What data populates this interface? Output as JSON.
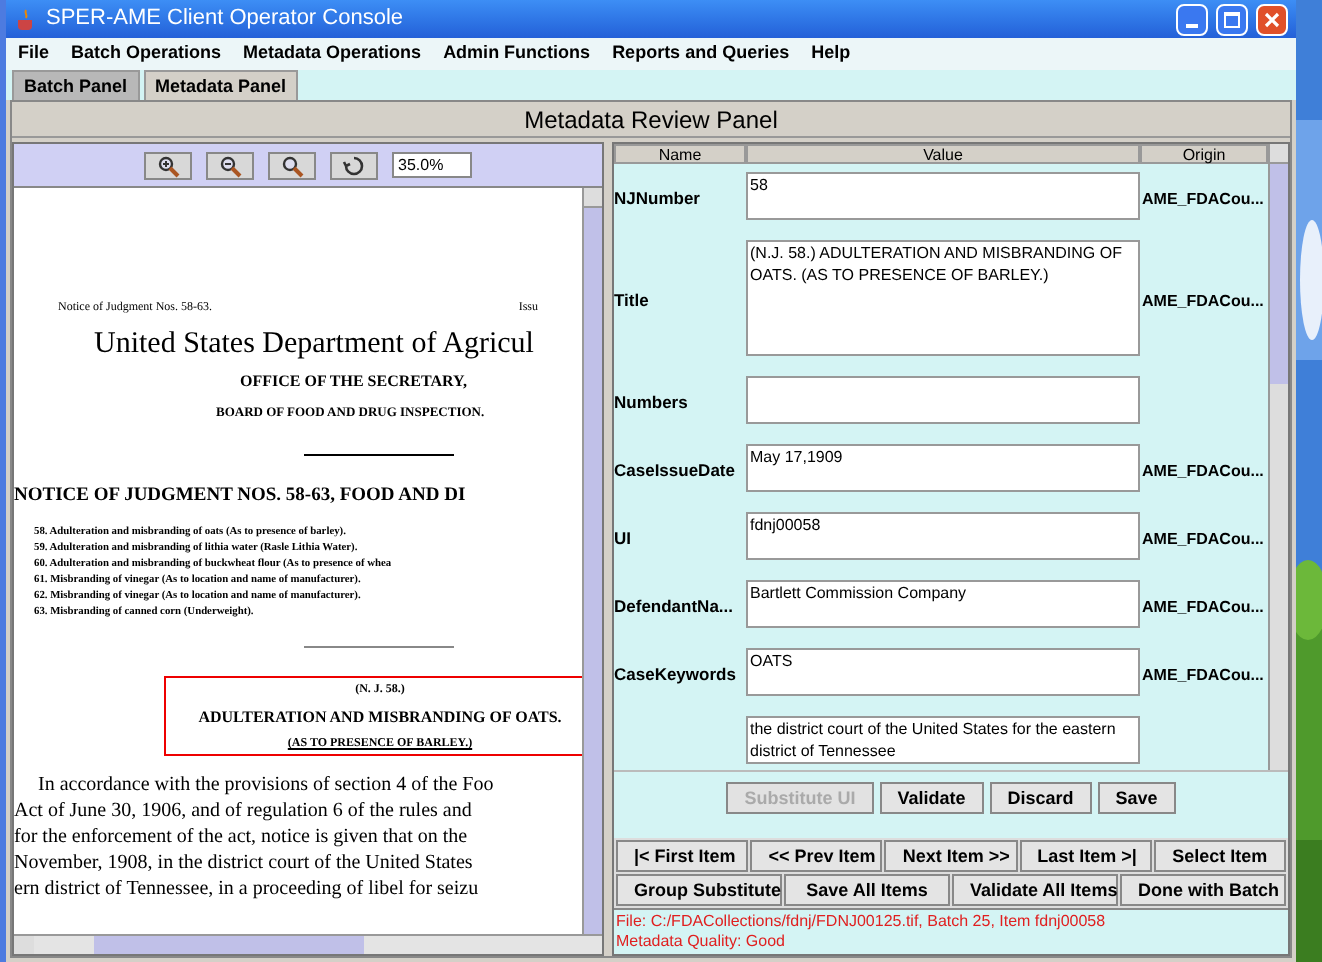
{
  "window": {
    "title": "SPER-AME Client Operator Console"
  },
  "menu": [
    "File",
    "Batch Operations",
    "Metadata Operations",
    "Admin Functions",
    "Reports and Queries",
    "Help"
  ],
  "tabs": [
    {
      "label": "Batch Panel",
      "selected": false
    },
    {
      "label": "Metadata Panel",
      "selected": true
    }
  ],
  "panel_title": "Metadata Review Panel",
  "viewer": {
    "zoom": "35.0%",
    "document": {
      "header_left": "Notice of Judgment Nos. 58-63.",
      "header_right": "Issu",
      "heading": "United States Department of Agricul",
      "office": "OFFICE OF THE SECRETARY,",
      "board": "BOARD OF FOOD AND DRUG INSPECTION.",
      "notice": "NOTICE OF JUDGMENT NOS. 58-63, FOOD AND DI",
      "items": [
        "58. Adulteration and misbranding of oats (As to presence of barley).",
        "59. Adulteration and misbranding of lithia water (Rasle Lithia Water).",
        "60. Adulteration and misbranding of buckwheat flour (As to presence of whea",
        "61. Misbranding of vinegar (As to location and name of manufacturer).",
        "62. Misbranding of vinegar (As to location and name of manufacturer).",
        "63. Misbranding of canned corn (Underweight)."
      ],
      "case_number": "(N. J. 58.)",
      "case_title": "ADULTERATION AND MISBRANDING OF OATS.",
      "case_subtitle": "(AS TO PRESENCE OF BARLEY.)",
      "body": [
        "In accordance with the provisions of section 4 of the Foo",
        "Act of June 30, 1906, and of regulation 6 of the rules and",
        "for the enforcement of the act, notice is given that on the",
        "November, 1908, in the district court of the United States",
        "ern district of Tennessee, in a proceeding of libel for seizu"
      ]
    }
  },
  "table": {
    "columns": [
      "Name",
      "Value",
      "Origin"
    ],
    "rows": [
      {
        "name": "NJNumber",
        "value": "58",
        "origin": "AME_FDACou...",
        "kind": "short"
      },
      {
        "name": "Title",
        "value": "(N.J. 58.) ADULTERATION AND MISBRANDING OF OATS. (AS TO PRESENCE OF BARLEY.)",
        "origin": "AME_FDACou...",
        "kind": "tall"
      },
      {
        "name": "Numbers",
        "kind": "short"
      },
      {
        "name": "CaseIssueDate",
        "value": "May 17,1909",
        "origin": "AME_FDACou...",
        "kind": "short"
      },
      {
        "name": "UI",
        "value": "fdnj00058",
        "origin": "AME_FDACou...",
        "kind": "short"
      },
      {
        "name": "DefendantNa...",
        "value": "Bartlett Commission Company",
        "origin": "AME_FDACou...",
        "kind": "short"
      },
      {
        "name": "CaseKeywords",
        "value": "OATS",
        "origin": "AME_FDACou...",
        "kind": "short"
      },
      {
        "value": "the district court of the United States for the eastern district of Tennessee",
        "kind": "short"
      }
    ]
  },
  "item_buttons": [
    {
      "label": "Substitute UI",
      "disabled": true
    },
    {
      "label": "Validate",
      "disabled": false
    },
    {
      "label": "Discard",
      "disabled": false
    },
    {
      "label": "Save",
      "disabled": false
    }
  ],
  "nav_buttons": [
    "|< First Item",
    "<< Prev Item",
    "Next Item >>",
    "Last Item >|",
    "Select Item"
  ],
  "batch_buttons": [
    "Group Substitute",
    "Save All Items",
    "Validate All Items",
    "Done with Batch"
  ],
  "status": [
    "File: C:/FDACollections/fdnj/FDNJ00125.tif, Batch 25, Item fdnj00058",
    "Metadata Quality: Good"
  ]
}
